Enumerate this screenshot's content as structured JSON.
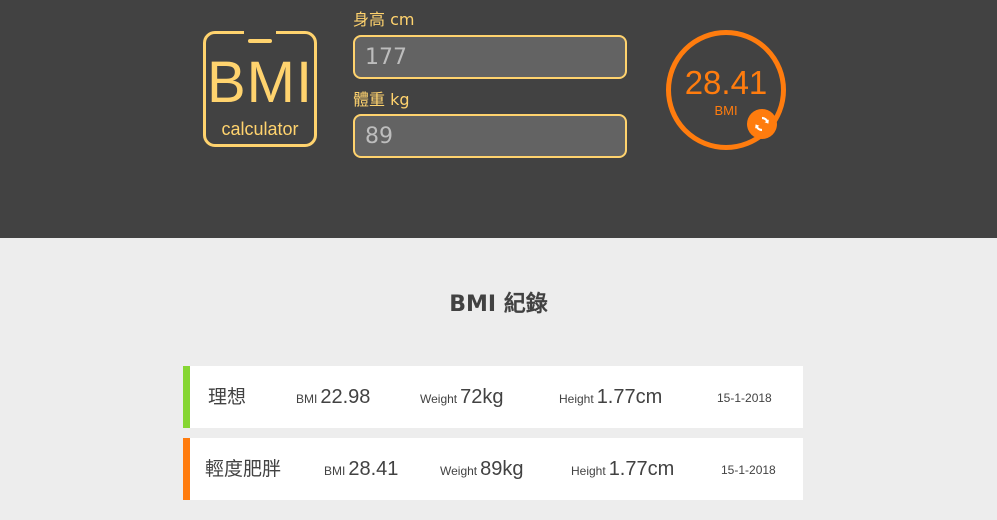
{
  "logo": {
    "big": "BMI",
    "small": "calculator"
  },
  "form": {
    "height_label": "身高 cm",
    "height_value": "177",
    "weight_label": "體重 kg",
    "weight_value": "89"
  },
  "result": {
    "value": "28.41",
    "unit": "BMI"
  },
  "icons": {
    "refresh": "refresh-icon"
  },
  "colors": {
    "accent": "#ffd36e",
    "orange": "#ff7c0e",
    "green": "#86d633"
  },
  "records": {
    "title": "BMI 紀錄",
    "items": [
      {
        "status": "理想",
        "status_color": "#86d633",
        "bmi_label": "BMI",
        "bmi": "22.98",
        "weight_label": "Weight",
        "weight": "72kg",
        "height_label": "Height",
        "height": "1.77cm",
        "date": "15-1-2018"
      },
      {
        "status": "輕度肥胖",
        "status_color": "#ff7c0e",
        "bmi_label": "BMI",
        "bmi": "28.41",
        "weight_label": "Weight",
        "weight": "89kg",
        "height_label": "Height",
        "height": "1.77cm",
        "date": "15-1-2018"
      }
    ]
  }
}
